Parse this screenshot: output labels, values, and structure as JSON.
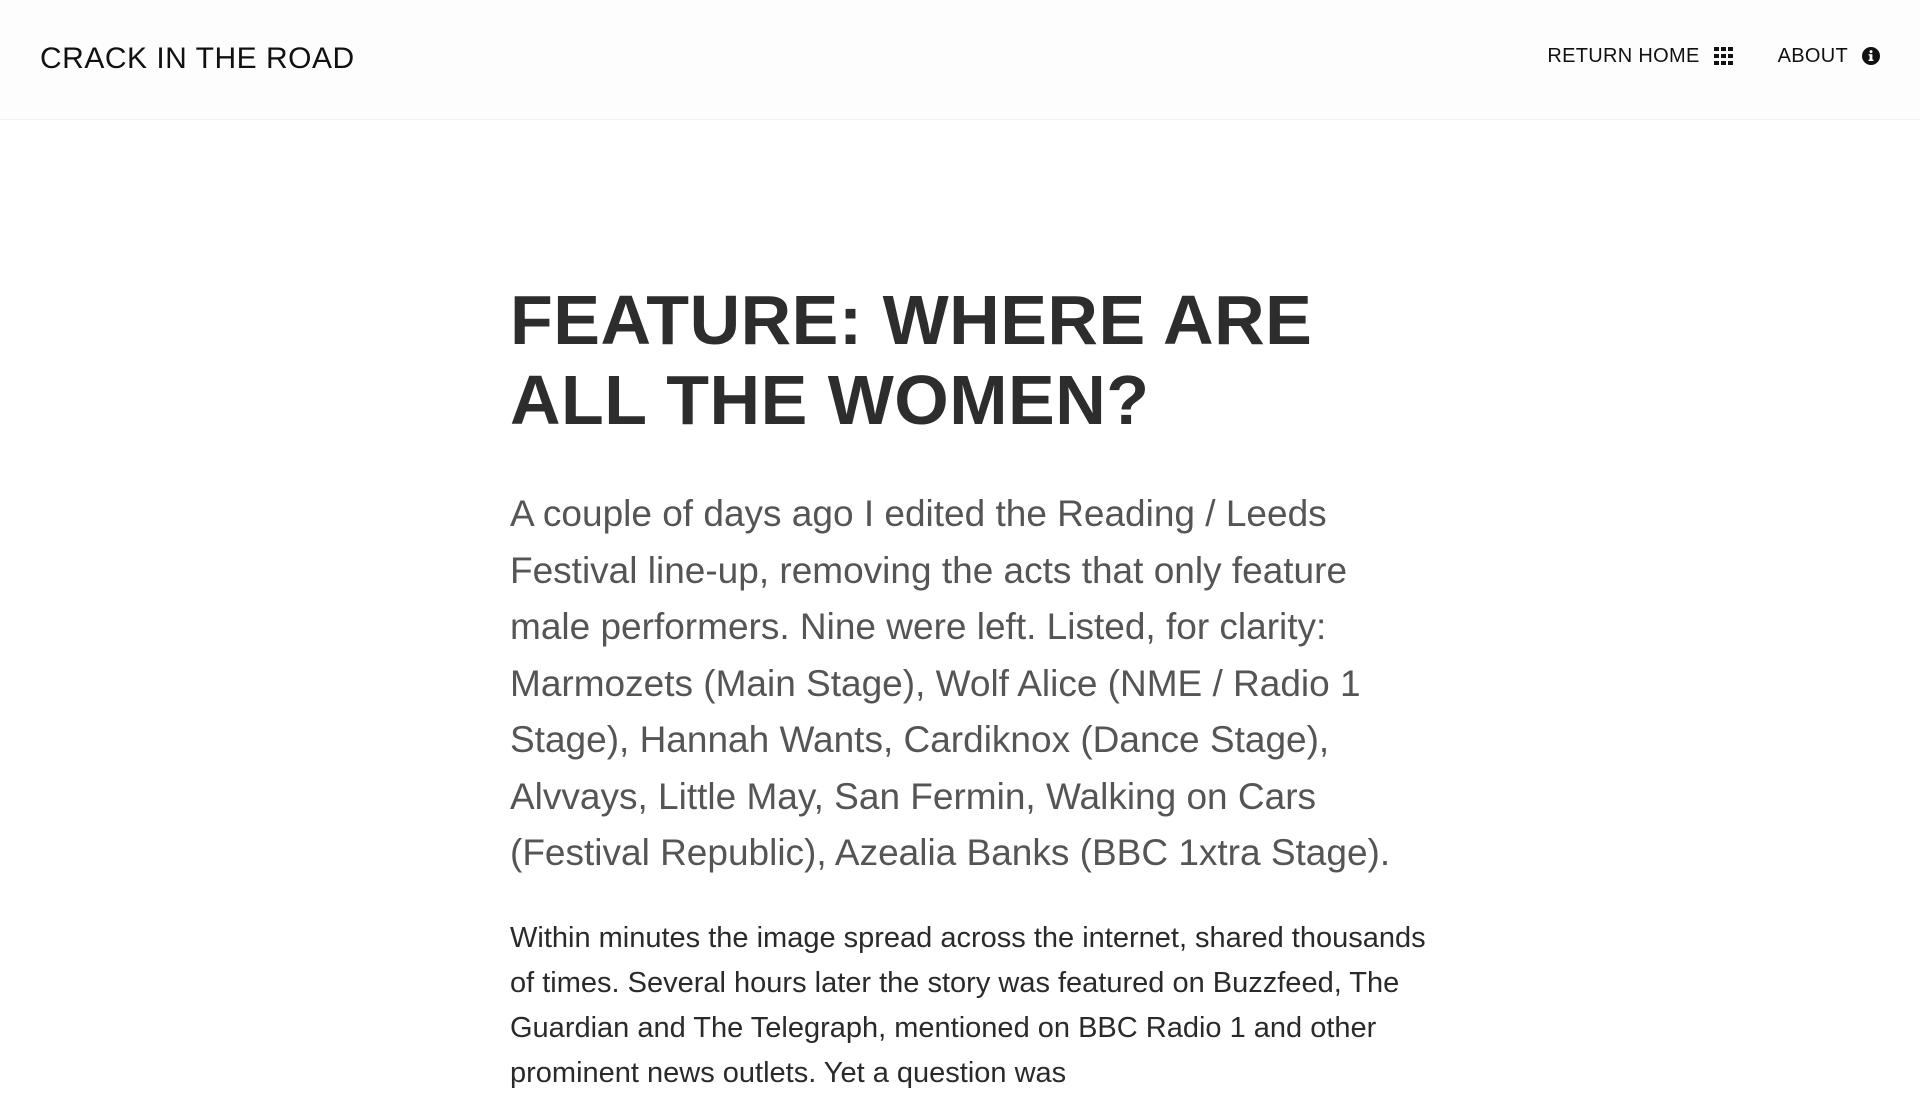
{
  "header": {
    "brand": "CRACK IN THE ROAD",
    "nav": [
      {
        "label": "RETURN HOME",
        "icon": "grid-icon"
      },
      {
        "label": "ABOUT",
        "icon": "info-icon"
      }
    ]
  },
  "article": {
    "title": "FEATURE: WHERE ARE ALL THE WOMEN?",
    "lede": "A couple of days ago I edited the Reading / Leeds Festival line-up, removing the acts that only feature male performers. Nine were left. Listed, for clarity: Marmozets (Main Stage), Wolf Alice (NME / Radio 1 Stage), Hannah Wants, Cardiknox (Dance Stage), Alvvays, Little May, San Fermin, Walking on Cars (Festival Republic), Azealia Banks (BBC 1xtra Stage).",
    "body": "Within minutes the image spread across the internet, shared thousands of times. Several hours later the story was featured on Buzzfeed, The Guardian and The Telegraph, mentioned on BBC Radio 1 and other prominent news outlets. Yet a question was"
  },
  "colors": {
    "title": "#2d2d2d",
    "lede": "#555555",
    "body": "#2a2a2a",
    "header_bg": "#fdfdfd"
  }
}
